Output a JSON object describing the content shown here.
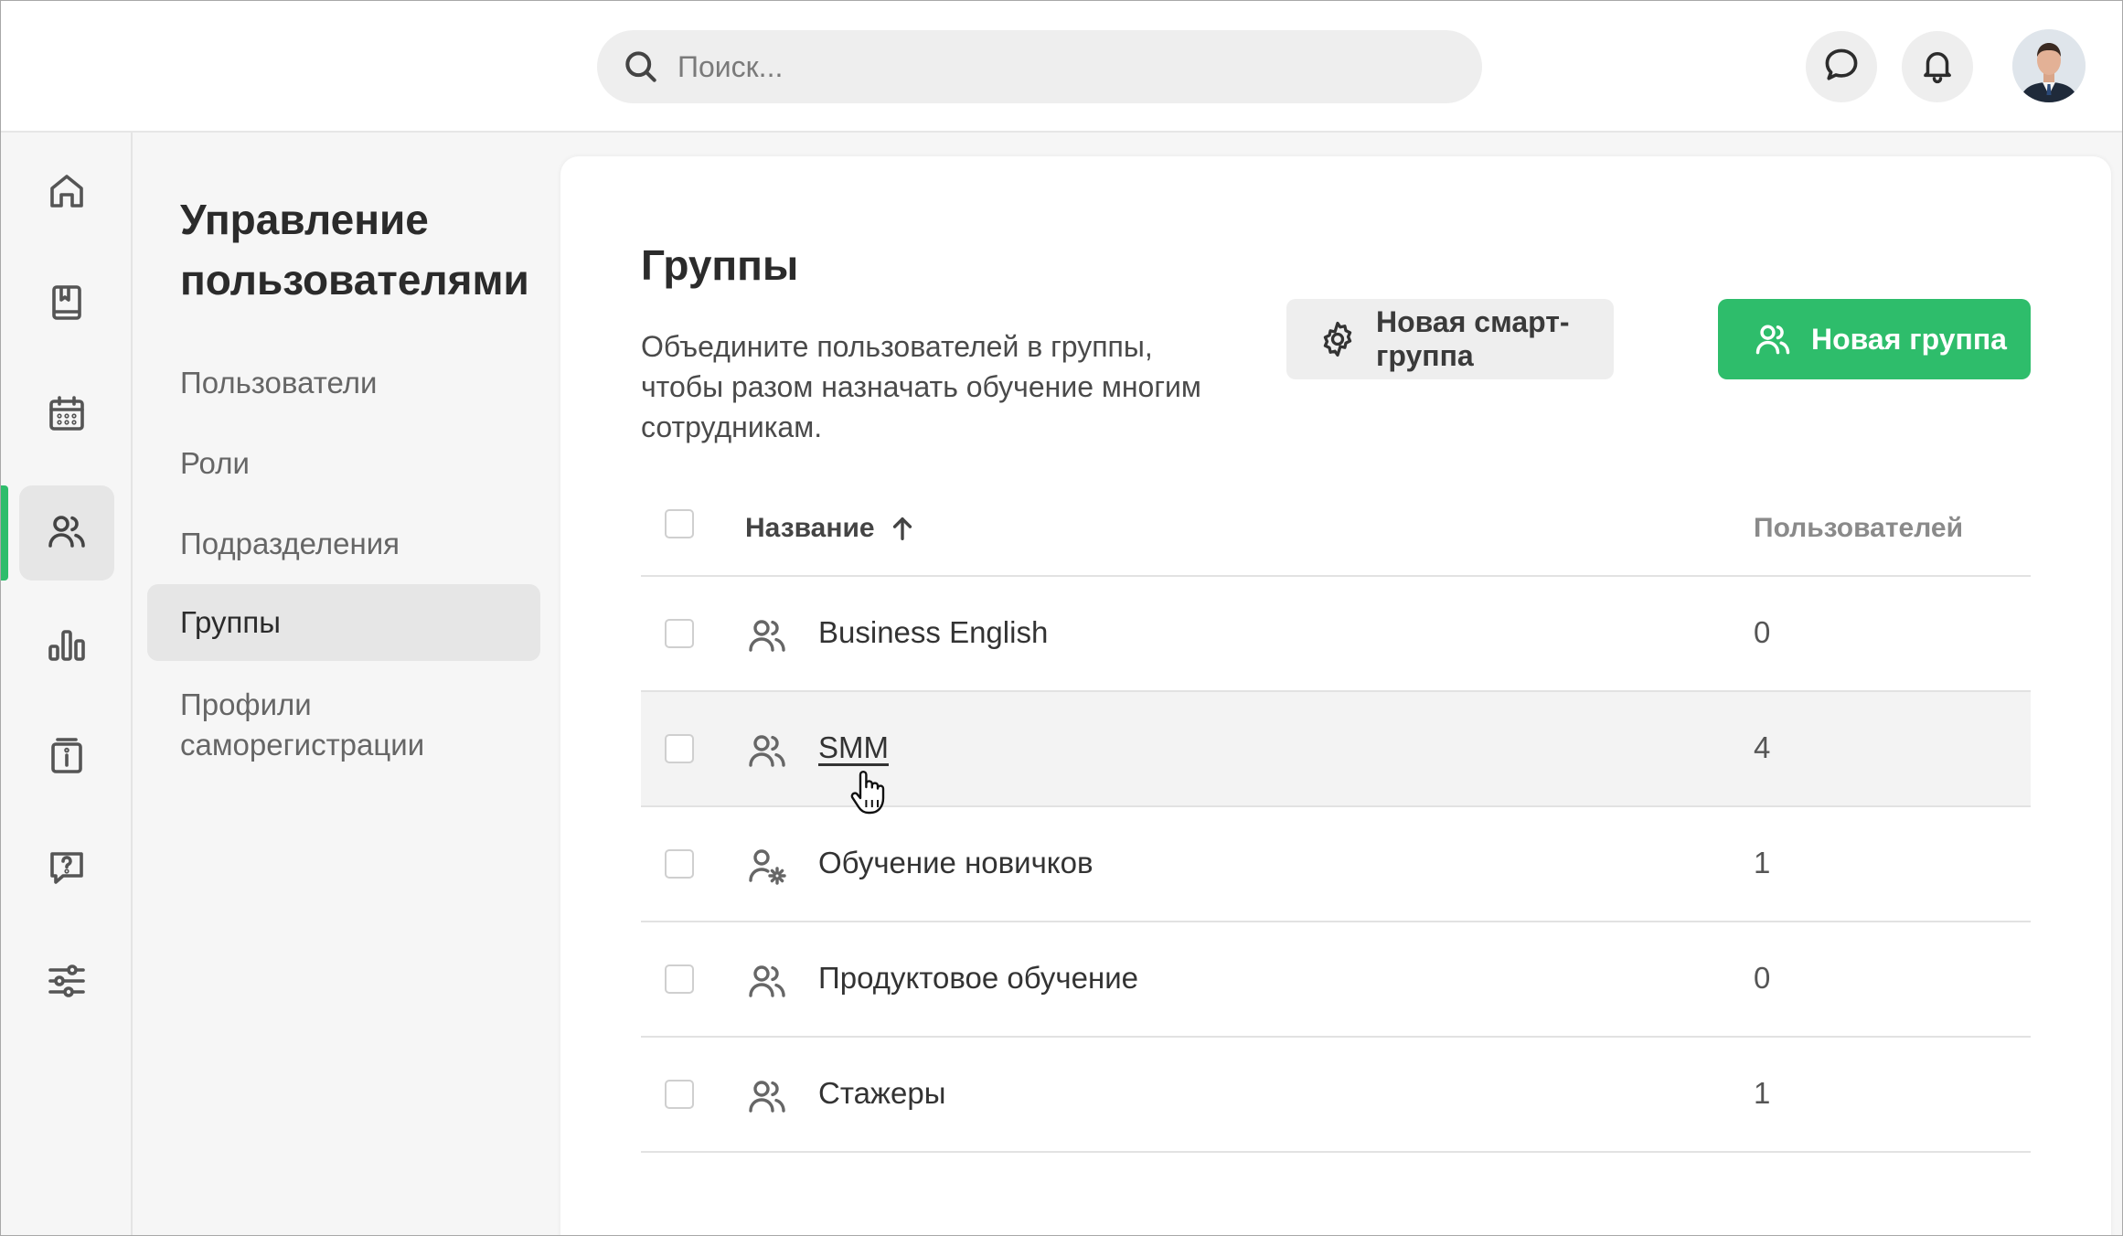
{
  "search": {
    "placeholder": "Поиск..."
  },
  "subnav": {
    "title": "Управление пользователями",
    "items": [
      {
        "label": "Пользователи"
      },
      {
        "label": "Роли"
      },
      {
        "label": "Подразделения"
      },
      {
        "label": "Группы",
        "active": true
      },
      {
        "label": "Профили саморегистрации"
      }
    ]
  },
  "main": {
    "title": "Группы",
    "description": "Объедините пользователей в группы, чтобы разом назначать обучение многим сотрудникам.",
    "buttons": {
      "smart_group": "Новая смарт-группа",
      "new_group": "Новая группа"
    },
    "table": {
      "col_name": "Название",
      "col_users": "Пользователей",
      "rows": [
        {
          "name": "Business English",
          "count": "0",
          "icon": "users-icon"
        },
        {
          "name": "SMM",
          "count": "4",
          "icon": "users-icon",
          "hovered": true
        },
        {
          "name": "Обучение новичков",
          "count": "1",
          "icon": "user-gear-icon"
        },
        {
          "name": "Продуктовое обучение",
          "count": "0",
          "icon": "users-icon"
        },
        {
          "name": "Стажеры",
          "count": "1",
          "icon": "users-icon"
        }
      ]
    }
  },
  "colors": {
    "accent": "#2ebd6b"
  }
}
